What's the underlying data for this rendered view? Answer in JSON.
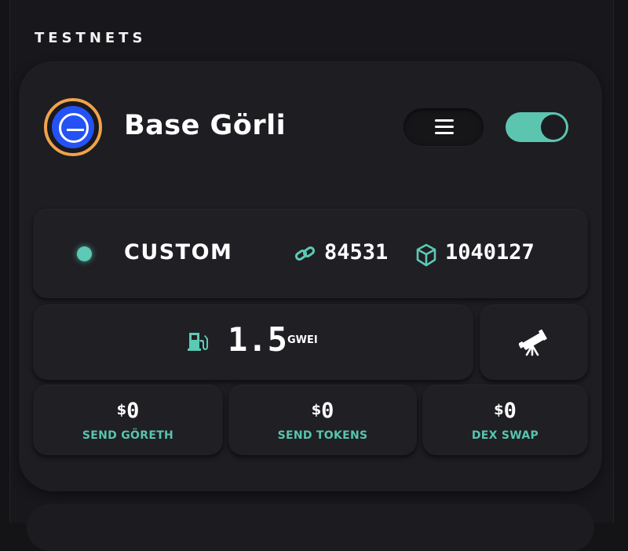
{
  "section": {
    "title": "TESTNETS"
  },
  "network": {
    "name": "Base Görli",
    "rpc_type": "CUSTOM",
    "chain_id": "84531",
    "block_height": "1040127",
    "gas_price": "1.5",
    "gas_unit": "GWEI",
    "enabled": true
  },
  "actions": [
    {
      "currency": "$",
      "amount": "0",
      "label": "SEND GÖRETH"
    },
    {
      "currency": "$",
      "amount": "0",
      "label": "SEND TOKENS"
    },
    {
      "currency": "$",
      "amount": "0",
      "label": "DEX SWAP"
    }
  ],
  "icons": {
    "network_logo": "base-logo-icon",
    "menu": "hamburger-menu-icon",
    "chain_id": "link-icon",
    "block": "cube-icon",
    "gas": "fuel-pump-icon",
    "explorer": "telescope-icon"
  },
  "colors": {
    "accent": "#5cc9b4",
    "logo_ring": "#f0a24b",
    "logo_fill": "#2452f5",
    "background": "#18181c"
  }
}
